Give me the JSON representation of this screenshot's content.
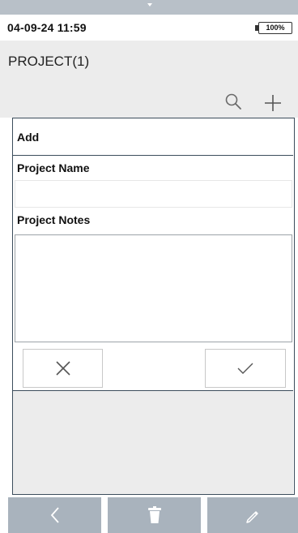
{
  "status_bar": {
    "datetime": "04-09-24 11:59",
    "battery": "100%"
  },
  "header": {
    "title": "PROJECT(1)",
    "icons": [
      "search-icon",
      "plus-icon"
    ]
  },
  "dialog": {
    "title": "Add",
    "project_name_label": "Project Name",
    "project_name_value": "",
    "project_notes_label": "Project Notes",
    "project_notes_value": "",
    "buttons": [
      "close-icon",
      "check-icon"
    ]
  },
  "bottom_nav": {
    "icons": [
      "chevron-left-icon",
      "trash-icon",
      "pencil-icon"
    ]
  },
  "colors": {
    "nav_button": "#a9b3bd",
    "panel_gray": "#ececec",
    "dialog_border": "#3c4d5c"
  }
}
